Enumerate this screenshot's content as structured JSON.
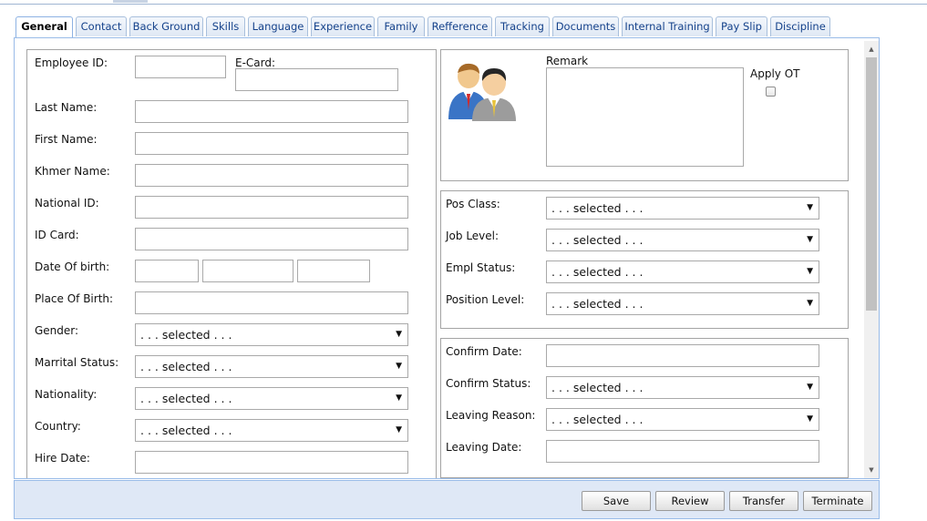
{
  "tabs": [
    "General",
    "Contact",
    "Back Ground",
    "Skills",
    "Language",
    "Experience",
    "Family",
    "Refference",
    "Tracking",
    "Documents",
    "Internal Training",
    "Pay Slip",
    "Discipline"
  ],
  "left": {
    "employee_id": "Employee ID:",
    "e_card": "E-Card:",
    "last_name": "Last Name:",
    "first_name": "First Name:",
    "khmer_name": "Khmer Name:",
    "national_id": "National ID:",
    "id_card": "ID Card:",
    "dob": "Date Of birth:",
    "pob": "Place Of Birth:",
    "gender": "Gender:",
    "marital": "Marrital Status:",
    "nationality": "Nationality:",
    "country": "Country:",
    "hire_date": "Hire Date:"
  },
  "selects": {
    "placeholder": ". . . selected . . ."
  },
  "top_right": {
    "remark": "Remark",
    "apply_ot": "Apply OT"
  },
  "position": {
    "pos_class": "Pos Class:",
    "job_level": "Job Level:",
    "empl_status": "Empl Status:",
    "position_level": "Position Level:"
  },
  "confirm": {
    "confirm_date": "Confirm Date:",
    "confirm_status": "Confirm Status:",
    "leaving_reason": "Leaving Reason:",
    "leaving_date": "Leaving Date:"
  },
  "buttons": {
    "save": "Save",
    "review": "Review",
    "transfer": "Transfer",
    "terminate": "Terminate"
  },
  "icons": {
    "dropdown": "dropdown-arrow-icon",
    "employee": "employee-users-icon"
  }
}
